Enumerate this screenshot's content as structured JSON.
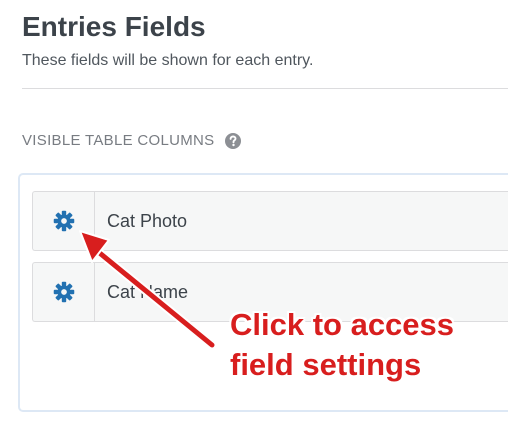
{
  "header": {
    "title": "Entries Fields",
    "subtitle": "These fields will be shown for each entry."
  },
  "visible_columns": {
    "label": "VISIBLE TABLE COLUMNS",
    "help_icon": "question-circle-icon",
    "rows": [
      {
        "icon": "gear-icon",
        "label": "Cat Photo"
      },
      {
        "icon": "gear-icon",
        "label": "Cat Name"
      }
    ]
  },
  "annotation": {
    "line1": "Click to access",
    "line2": "field settings"
  },
  "colors": {
    "gear": "#2271b1",
    "annotation": "#d81e1e",
    "help_icon": "#8c8f94"
  }
}
